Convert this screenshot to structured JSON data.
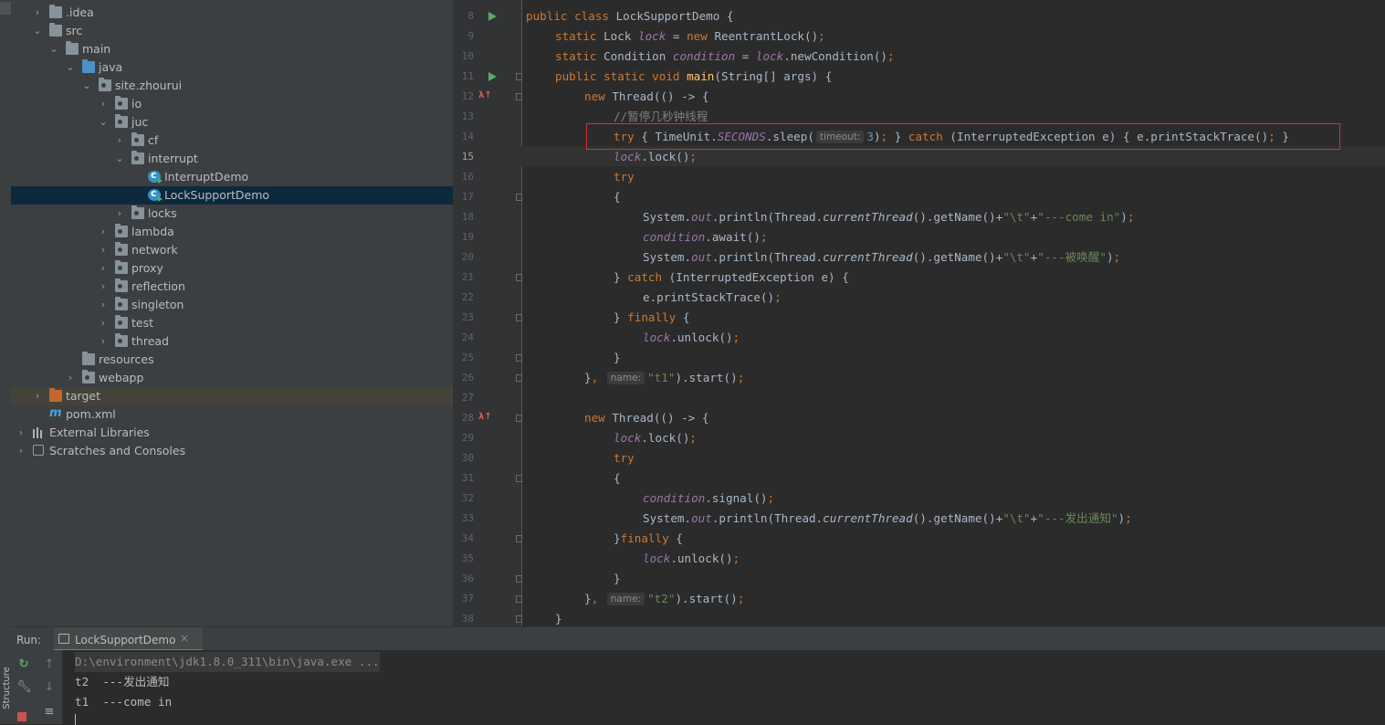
{
  "tree": {
    "items": [
      {
        "label": ".idea",
        "level": 1,
        "arrow": "›",
        "icon": "folder"
      },
      {
        "label": "src",
        "level": 1,
        "arrow": "⌄",
        "icon": "folder"
      },
      {
        "label": "main",
        "level": 2,
        "arrow": "⌄",
        "icon": "folder"
      },
      {
        "label": "java",
        "level": 3,
        "arrow": "⌄",
        "icon": "folder-src"
      },
      {
        "label": "site.zhourui",
        "level": 4,
        "arrow": "⌄",
        "icon": "package"
      },
      {
        "label": "io",
        "level": 5,
        "arrow": "›",
        "icon": "package"
      },
      {
        "label": "juc",
        "level": 5,
        "arrow": "⌄",
        "icon": "package"
      },
      {
        "label": "cf",
        "level": 6,
        "arrow": "›",
        "icon": "package"
      },
      {
        "label": "interrupt",
        "level": 6,
        "arrow": "⌄",
        "icon": "package"
      },
      {
        "label": "InterruptDemo",
        "level": 7,
        "arrow": "",
        "icon": "class"
      },
      {
        "label": "LockSupportDemo",
        "level": 7,
        "arrow": "",
        "icon": "class",
        "selected": true
      },
      {
        "label": "locks",
        "level": 6,
        "arrow": "›",
        "icon": "package"
      },
      {
        "label": "lambda",
        "level": 5,
        "arrow": "›",
        "icon": "package"
      },
      {
        "label": "network",
        "level": 5,
        "arrow": "›",
        "icon": "package"
      },
      {
        "label": "proxy",
        "level": 5,
        "arrow": "›",
        "icon": "package"
      },
      {
        "label": "reflection",
        "level": 5,
        "arrow": "›",
        "icon": "package"
      },
      {
        "label": "singleton",
        "level": 5,
        "arrow": "›",
        "icon": "package"
      },
      {
        "label": "test",
        "level": 5,
        "arrow": "›",
        "icon": "package"
      },
      {
        "label": "thread",
        "level": 5,
        "arrow": "›",
        "icon": "package"
      },
      {
        "label": "resources",
        "level": 3,
        "arrow": "",
        "icon": "folder"
      },
      {
        "label": "webapp",
        "level": 3,
        "arrow": "›",
        "icon": "package"
      },
      {
        "label": "target",
        "level": 1,
        "arrow": "›",
        "icon": "folder-target",
        "highlight": true
      },
      {
        "label": "pom.xml",
        "level": 1,
        "arrow": "",
        "icon": "maven"
      },
      {
        "label": "External Libraries",
        "level": 0,
        "arrow": "›",
        "icon": "libraries"
      },
      {
        "label": "Scratches and Consoles",
        "level": 0,
        "arrow": "›",
        "icon": "scratches"
      }
    ]
  },
  "editor": {
    "current_line": 15,
    "run_lines": [
      8,
      11
    ],
    "lambda_lines": [
      12,
      28
    ],
    "fold_lines": [
      11,
      12,
      17,
      21,
      23,
      25,
      26,
      28,
      31,
      34,
      36,
      37,
      38
    ],
    "lines": [
      {
        "num": 8,
        "indent": 0,
        "tokens": [
          [
            "k",
            "public class "
          ],
          [
            "",
            "LockSupportDemo {"
          ]
        ]
      },
      {
        "num": 9,
        "indent": 1,
        "tokens": [
          [
            "k",
            "static "
          ],
          [
            "",
            "Lock "
          ],
          [
            "f",
            "lock"
          ],
          [
            "",
            " = "
          ],
          [
            "k",
            "new "
          ],
          [
            "",
            "ReentrantLock()"
          ],
          [
            "k",
            ";"
          ]
        ]
      },
      {
        "num": 10,
        "indent": 1,
        "tokens": [
          [
            "k",
            "static "
          ],
          [
            "",
            "Condition "
          ],
          [
            "f",
            "condition"
          ],
          [
            "",
            " = "
          ],
          [
            "f",
            "lock"
          ],
          [
            "",
            ".newCondition()"
          ],
          [
            "k",
            ";"
          ]
        ]
      },
      {
        "num": 11,
        "indent": 1,
        "tokens": [
          [
            "k",
            "public static void "
          ],
          [
            "m",
            "main"
          ],
          [
            "",
            "(String[] args) {"
          ]
        ]
      },
      {
        "num": 12,
        "indent": 2,
        "tokens": [
          [
            "k",
            "new "
          ],
          [
            "",
            "Thread(() -> {"
          ]
        ]
      },
      {
        "num": 13,
        "indent": 3,
        "tokens": [
          [
            "c",
            "//暂停几秒钟线程"
          ]
        ]
      },
      {
        "num": 14,
        "indent": 3,
        "tokens": [
          [
            "k",
            "try "
          ],
          [
            "",
            "{ TimeUnit."
          ],
          [
            "f",
            "SECONDS"
          ],
          [
            "",
            ".sleep("
          ],
          [
            "hint",
            "timeout:"
          ],
          [
            "n",
            "3"
          ],
          [
            "",
            ")"
          ],
          [
            "k",
            "; "
          ],
          [
            "",
            "} "
          ],
          [
            "k",
            "catch "
          ],
          [
            "",
            "(InterruptedException e) { e.printStackTrace()"
          ],
          [
            "k",
            "; "
          ],
          [
            "",
            "}"
          ]
        ]
      },
      {
        "num": 15,
        "indent": 3,
        "tokens": [
          [
            "f",
            "lock"
          ],
          [
            "",
            ".lock()"
          ],
          [
            "k",
            ";"
          ]
        ]
      },
      {
        "num": 16,
        "indent": 3,
        "tokens": [
          [
            "k",
            "try"
          ]
        ]
      },
      {
        "num": 17,
        "indent": 3,
        "tokens": [
          [
            "",
            "{"
          ]
        ]
      },
      {
        "num": 18,
        "indent": 4,
        "tokens": [
          [
            "",
            "System."
          ],
          [
            "f",
            "out"
          ],
          [
            "",
            ".println(Thread."
          ],
          [
            "it",
            "currentThread"
          ],
          [
            "",
            "().getName()+"
          ],
          [
            "s",
            "\"\\t\""
          ],
          [
            "",
            "+"
          ],
          [
            "s",
            "\"---come in\""
          ],
          [
            "",
            ")"
          ],
          [
            "k",
            ";"
          ]
        ]
      },
      {
        "num": 19,
        "indent": 4,
        "tokens": [
          [
            "f",
            "condition"
          ],
          [
            "",
            ".await()"
          ],
          [
            "k",
            ";"
          ]
        ]
      },
      {
        "num": 20,
        "indent": 4,
        "tokens": [
          [
            "",
            "System."
          ],
          [
            "f",
            "out"
          ],
          [
            "",
            ".println(Thread."
          ],
          [
            "it",
            "currentThread"
          ],
          [
            "",
            "().getName()+"
          ],
          [
            "s",
            "\"\\t\""
          ],
          [
            "",
            "+"
          ],
          [
            "s",
            "\"---被唤醒\""
          ],
          [
            "",
            ")"
          ],
          [
            "k",
            ";"
          ]
        ]
      },
      {
        "num": 21,
        "indent": 3,
        "tokens": [
          [
            "",
            "} "
          ],
          [
            "k",
            "catch "
          ],
          [
            "",
            "(InterruptedException e) {"
          ]
        ]
      },
      {
        "num": 22,
        "indent": 4,
        "tokens": [
          [
            "",
            "e.printStackTrace()"
          ],
          [
            "k",
            ";"
          ]
        ]
      },
      {
        "num": 23,
        "indent": 3,
        "tokens": [
          [
            "",
            "} "
          ],
          [
            "k",
            "finally "
          ],
          [
            "",
            "{"
          ]
        ]
      },
      {
        "num": 24,
        "indent": 4,
        "tokens": [
          [
            "f",
            "lock"
          ],
          [
            "",
            ".unlock()"
          ],
          [
            "k",
            ";"
          ]
        ]
      },
      {
        "num": 25,
        "indent": 3,
        "tokens": [
          [
            "",
            "}"
          ]
        ]
      },
      {
        "num": 26,
        "indent": 2,
        "tokens": [
          [
            "",
            "}"
          ],
          [
            "k",
            ", "
          ],
          [
            "hint",
            "name:"
          ],
          [
            "s",
            "\"t1\""
          ],
          [
            "",
            ").start()"
          ],
          [
            "k",
            ";"
          ]
        ]
      },
      {
        "num": 27,
        "indent": 0,
        "tokens": []
      },
      {
        "num": 28,
        "indent": 2,
        "tokens": [
          [
            "k",
            "new "
          ],
          [
            "",
            "Thread(() -> {"
          ]
        ]
      },
      {
        "num": 29,
        "indent": 3,
        "tokens": [
          [
            "f",
            "lock"
          ],
          [
            "",
            ".lock()"
          ],
          [
            "k",
            ";"
          ]
        ]
      },
      {
        "num": 30,
        "indent": 3,
        "tokens": [
          [
            "k",
            "try"
          ]
        ]
      },
      {
        "num": 31,
        "indent": 3,
        "tokens": [
          [
            "",
            "{"
          ]
        ]
      },
      {
        "num": 32,
        "indent": 4,
        "tokens": [
          [
            "f",
            "condition"
          ],
          [
            "",
            ".signal()"
          ],
          [
            "k",
            ";"
          ]
        ]
      },
      {
        "num": 33,
        "indent": 4,
        "tokens": [
          [
            "",
            "System."
          ],
          [
            "f",
            "out"
          ],
          [
            "",
            ".println(Thread."
          ],
          [
            "it",
            "currentThread"
          ],
          [
            "",
            "().getName()+"
          ],
          [
            "s",
            "\"\\t\""
          ],
          [
            "",
            "+"
          ],
          [
            "s",
            "\"---发出通知\""
          ],
          [
            "",
            ")"
          ],
          [
            "k",
            ";"
          ]
        ]
      },
      {
        "num": 34,
        "indent": 3,
        "tokens": [
          [
            "",
            "}"
          ],
          [
            "k",
            "finally "
          ],
          [
            "",
            "{"
          ]
        ]
      },
      {
        "num": 35,
        "indent": 4,
        "tokens": [
          [
            "f",
            "lock"
          ],
          [
            "",
            ".unlock()"
          ],
          [
            "k",
            ";"
          ]
        ]
      },
      {
        "num": 36,
        "indent": 3,
        "tokens": [
          [
            "",
            "}"
          ]
        ]
      },
      {
        "num": 37,
        "indent": 2,
        "tokens": [
          [
            "",
            "}"
          ],
          [
            "k",
            ", "
          ],
          [
            "hint",
            "name:"
          ],
          [
            "s",
            "\"t2\""
          ],
          [
            "",
            ").start()"
          ],
          [
            "k",
            ";"
          ]
        ]
      },
      {
        "num": 38,
        "indent": 1,
        "tokens": [
          [
            "",
            "}"
          ]
        ]
      }
    ]
  },
  "run": {
    "label": "Run:",
    "tab_title": "LockSupportDemo",
    "tab_close": "×",
    "structure_label": "Structure",
    "console_lines": [
      "D:\\environment\\jdk1.8.0_311\\bin\\java.exe ...",
      "t2  ---发出通知",
      "t1  ---come in"
    ]
  },
  "colors": {
    "keyword": "#cc7832",
    "field": "#9876aa",
    "method": "#ffc66d",
    "string": "#6a8759",
    "comment": "#808080",
    "number": "#6897bb",
    "highlight_box": "#d23232"
  }
}
